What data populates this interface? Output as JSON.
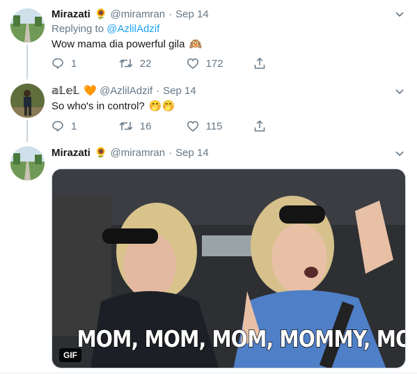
{
  "tweets": [
    {
      "name": "Mirazati",
      "name_emoji": "🌻",
      "handle": "@miramran",
      "separator": "·",
      "date": "Sep 14",
      "reply_prefix": "Replying to",
      "reply_mention": "@AzlilAdzif",
      "text": "Wow mama dia powerful gila",
      "text_emoji": "🙉",
      "replies": "1",
      "retweets": "22",
      "likes": "172"
    },
    {
      "name": "𝕒𝕃𝕖𝕃",
      "name_emoji": "🧡",
      "handle": "@AzlilAdzif",
      "separator": "·",
      "date": "Sep 14",
      "text": "So who's in control?",
      "text_emoji": "🤭🤭",
      "replies": "1",
      "retweets": "16",
      "likes": "115"
    },
    {
      "name": "Mirazati",
      "name_emoji": "🌻",
      "handle": "@miramran",
      "separator": "·",
      "date": "Sep 14",
      "media": {
        "caption": "MOM, MOM, MOM, MOMMY, MOM",
        "badge": "GIF"
      }
    }
  ],
  "colors": {
    "text": "#14171a",
    "secondary": "#657786",
    "link": "#1da1f2",
    "thread_line": "#ccd6dd"
  },
  "icons": {
    "reply": "reply-icon",
    "retweet": "retweet-icon",
    "like": "like-icon",
    "share": "share-icon",
    "more": "chevron-down-icon"
  }
}
